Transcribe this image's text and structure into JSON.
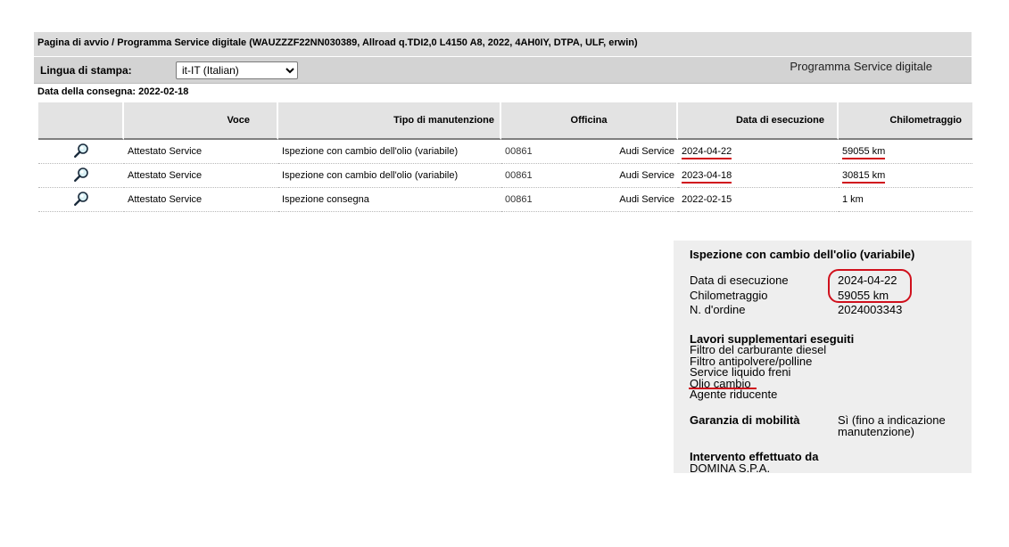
{
  "breadcrumb": "Pagina di avvio / Programma Service digitale (WAUZZZF22NN030389, Allroad q.TDI2,0 L4150 A8, 2022, 4AH0IY, DTPA, ULF, erwin)",
  "language": {
    "label": "Lingua di stampa:",
    "selected": "it-IT (Italian)"
  },
  "program_title": "Programma Service digitale",
  "delivery_date": "Data della consegna: 2022-02-18",
  "table": {
    "headers": {
      "voce": "Voce",
      "tipo": "Tipo di manutenzione",
      "officina": "Officina",
      "data": "Data di esecuzione",
      "km": "Chilometraggio"
    },
    "rows": [
      {
        "voce": "Attestato Service",
        "tipo": "Ispezione con cambio dell'olio (variabile)",
        "code": "00861",
        "workshop": "Audi Service",
        "date": "2024-04-22",
        "km": "59055 km"
      },
      {
        "voce": "Attestato Service",
        "tipo": "Ispezione con cambio dell'olio (variabile)",
        "code": "00861",
        "workshop": "Audi Service",
        "date": "2023-04-18",
        "km": "30815 km"
      },
      {
        "voce": "Attestato Service",
        "tipo": "Ispezione consegna",
        "code": "00861",
        "workshop": "Audi Service",
        "date": "2022-02-15",
        "km": "1 km"
      }
    ]
  },
  "detail": {
    "title": "Ispezione con cambio dell'olio (variabile)",
    "fields": [
      {
        "label": "Data di esecuzione",
        "value": "2024-04-22"
      },
      {
        "label": "Chilometraggio",
        "value": "59055 km"
      },
      {
        "label": "N. d'ordine",
        "value": "2024003343"
      }
    ],
    "extra_title": "Lavori supplementari eseguiti",
    "extra_items": [
      "Filtro del carburante diesel",
      "Filtro antipolvere/polline",
      "Service liquido freni",
      "Olio cambio",
      "Agente riducente"
    ],
    "mobility_label": "Garanzia di mobilità",
    "mobility_value_1": "Sì (fino a indicazione",
    "mobility_value_2": "manutenzione)",
    "performed_by_label": "Intervento effettuato da",
    "performed_by_value": "DOMINA S.P.A."
  },
  "colors": {
    "annotation_red": "#d0101c",
    "header_gray": "#e3e3e3"
  },
  "icons": {
    "row_icon": "magnifier-icon"
  }
}
